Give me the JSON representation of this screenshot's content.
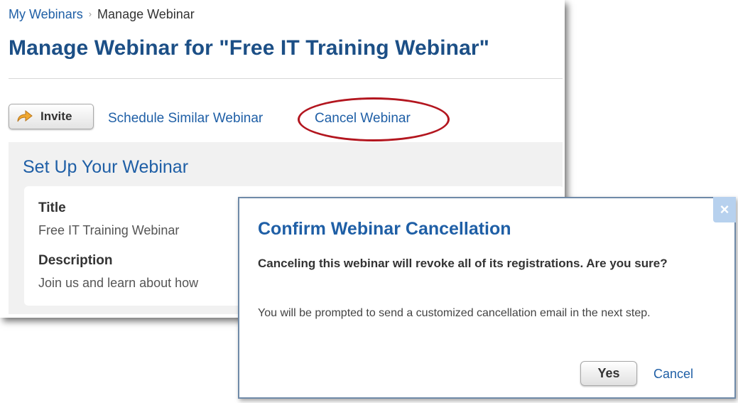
{
  "breadcrumb": {
    "parent": "My Webinars",
    "separator": "›",
    "current": "Manage Webinar"
  },
  "page_title": "Manage Webinar for \"Free IT Training Webinar\"",
  "actions": {
    "invite_label": "Invite",
    "schedule_similar_label": "Schedule Similar Webinar",
    "cancel_webinar_label": "Cancel Webinar"
  },
  "setup": {
    "heading": "Set Up Your Webinar",
    "title_label": "Title",
    "title_value": "Free IT Training Webinar",
    "description_label": "Description",
    "description_value": "Join us and learn about how"
  },
  "dialog": {
    "close_glyph": "×",
    "title": "Confirm Webinar Cancellation",
    "message": "Canceling this webinar will revoke all of its registrations. Are you sure?",
    "note": "You will be prompted to send a customized cancellation email in the next step.",
    "yes_label": "Yes",
    "cancel_label": "Cancel"
  },
  "colors": {
    "link": "#1f5fa6",
    "title": "#1c4f86",
    "highlight": "#b3161f",
    "dialog_border": "#6f8aa8",
    "close_button": "#b7d1ee"
  },
  "icons": {
    "invite": "arrow-right-icon",
    "close": "close-icon"
  }
}
